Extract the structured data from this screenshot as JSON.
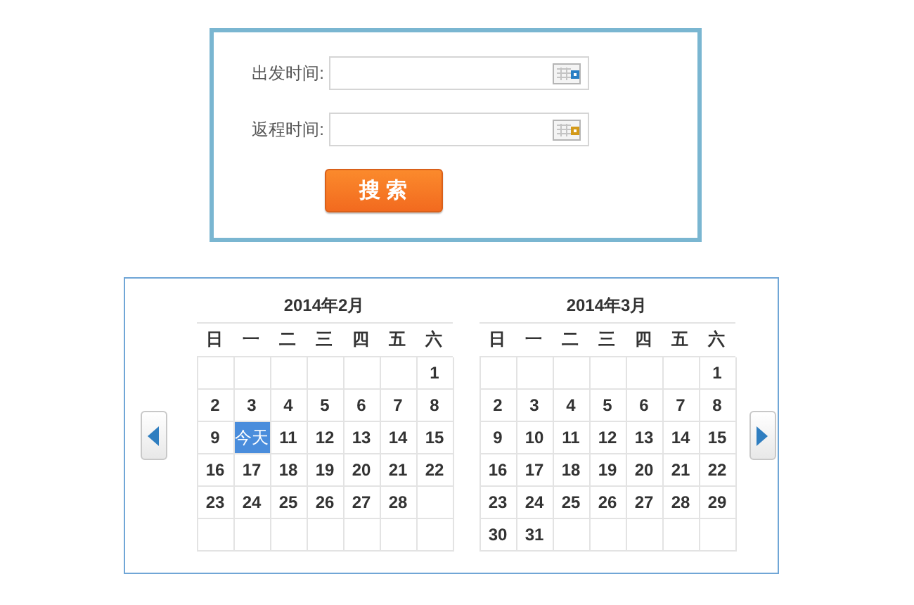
{
  "form": {
    "fields": [
      {
        "label": "出发时间:",
        "color": "#2a7fc4"
      },
      {
        "label": "返程时间:",
        "color": "#d39a1a"
      }
    ],
    "search_button": "搜 索"
  },
  "calendar": {
    "months": [
      {
        "title": "2014年2月",
        "weekdays": [
          "日",
          "一",
          "二",
          "三",
          "四",
          "五",
          "六"
        ],
        "weeks": [
          [
            {
              "kind": "blank"
            },
            {
              "kind": "blank"
            },
            {
              "kind": "blank"
            },
            {
              "kind": "blank"
            },
            {
              "kind": "blank"
            },
            {
              "kind": "blank"
            },
            {
              "kind": "day",
              "day": "1",
              "today": false
            }
          ],
          [
            {
              "kind": "day",
              "day": "2",
              "today": false
            },
            {
              "kind": "day",
              "day": "3",
              "today": false
            },
            {
              "kind": "day",
              "day": "4",
              "today": false
            },
            {
              "kind": "day",
              "day": "5",
              "today": false
            },
            {
              "kind": "day",
              "day": "6",
              "today": false
            },
            {
              "kind": "day",
              "day": "7",
              "today": false
            },
            {
              "kind": "day",
              "day": "8",
              "today": false
            }
          ],
          [
            {
              "kind": "day",
              "day": "9",
              "today": false
            },
            {
              "kind": "day",
              "day": "今天",
              "today": true
            },
            {
              "kind": "day",
              "day": "11",
              "today": false
            },
            {
              "kind": "day",
              "day": "12",
              "today": false
            },
            {
              "kind": "day",
              "day": "13",
              "today": false
            },
            {
              "kind": "day",
              "day": "14",
              "today": false
            },
            {
              "kind": "day",
              "day": "15",
              "today": false
            }
          ],
          [
            {
              "kind": "day",
              "day": "16",
              "today": false
            },
            {
              "kind": "day",
              "day": "17",
              "today": false
            },
            {
              "kind": "day",
              "day": "18",
              "today": false
            },
            {
              "kind": "day",
              "day": "19",
              "today": false
            },
            {
              "kind": "day",
              "day": "20",
              "today": false
            },
            {
              "kind": "day",
              "day": "21",
              "today": false
            },
            {
              "kind": "day",
              "day": "22",
              "today": false
            }
          ],
          [
            {
              "kind": "day",
              "day": "23",
              "today": false
            },
            {
              "kind": "day",
              "day": "24",
              "today": false
            },
            {
              "kind": "day",
              "day": "25",
              "today": false
            },
            {
              "kind": "day",
              "day": "26",
              "today": false
            },
            {
              "kind": "day",
              "day": "27",
              "today": false
            },
            {
              "kind": "day",
              "day": "28",
              "today": false
            },
            {
              "kind": "blank"
            }
          ],
          [
            {
              "kind": "blank"
            },
            {
              "kind": "blank"
            },
            {
              "kind": "blank"
            },
            {
              "kind": "blank"
            },
            {
              "kind": "blank"
            },
            {
              "kind": "blank"
            },
            {
              "kind": "blank"
            }
          ]
        ]
      },
      {
        "title": "2014年3月",
        "weekdays": [
          "日",
          "一",
          "二",
          "三",
          "四",
          "五",
          "六"
        ],
        "weeks": [
          [
            {
              "kind": "blank"
            },
            {
              "kind": "blank"
            },
            {
              "kind": "blank"
            },
            {
              "kind": "blank"
            },
            {
              "kind": "blank"
            },
            {
              "kind": "blank"
            },
            {
              "kind": "day",
              "day": "1",
              "today": false
            }
          ],
          [
            {
              "kind": "day",
              "day": "2",
              "today": false
            },
            {
              "kind": "day",
              "day": "3",
              "today": false
            },
            {
              "kind": "day",
              "day": "4",
              "today": false
            },
            {
              "kind": "day",
              "day": "5",
              "today": false
            },
            {
              "kind": "day",
              "day": "6",
              "today": false
            },
            {
              "kind": "day",
              "day": "7",
              "today": false
            },
            {
              "kind": "day",
              "day": "8",
              "today": false
            }
          ],
          [
            {
              "kind": "day",
              "day": "9",
              "today": false
            },
            {
              "kind": "day",
              "day": "10",
              "today": false
            },
            {
              "kind": "day",
              "day": "11",
              "today": false
            },
            {
              "kind": "day",
              "day": "12",
              "today": false
            },
            {
              "kind": "day",
              "day": "13",
              "today": false
            },
            {
              "kind": "day",
              "day": "14",
              "today": false
            },
            {
              "kind": "day",
              "day": "15",
              "today": false
            }
          ],
          [
            {
              "kind": "day",
              "day": "16",
              "today": false
            },
            {
              "kind": "day",
              "day": "17",
              "today": false
            },
            {
              "kind": "day",
              "day": "18",
              "today": false
            },
            {
              "kind": "day",
              "day": "19",
              "today": false
            },
            {
              "kind": "day",
              "day": "20",
              "today": false
            },
            {
              "kind": "day",
              "day": "21",
              "today": false
            },
            {
              "kind": "day",
              "day": "22",
              "today": false
            }
          ],
          [
            {
              "kind": "day",
              "day": "23",
              "today": false
            },
            {
              "kind": "day",
              "day": "24",
              "today": false
            },
            {
              "kind": "day",
              "day": "25",
              "today": false
            },
            {
              "kind": "day",
              "day": "26",
              "today": false
            },
            {
              "kind": "day",
              "day": "27",
              "today": false
            },
            {
              "kind": "day",
              "day": "28",
              "today": false
            },
            {
              "kind": "day",
              "day": "29",
              "today": false
            }
          ],
          [
            {
              "kind": "day",
              "day": "30",
              "today": false
            },
            {
              "kind": "day",
              "day": "31",
              "today": false
            },
            {
              "kind": "blank"
            },
            {
              "kind": "blank"
            },
            {
              "kind": "blank"
            },
            {
              "kind": "blank"
            },
            {
              "kind": "blank"
            }
          ]
        ]
      }
    ]
  }
}
